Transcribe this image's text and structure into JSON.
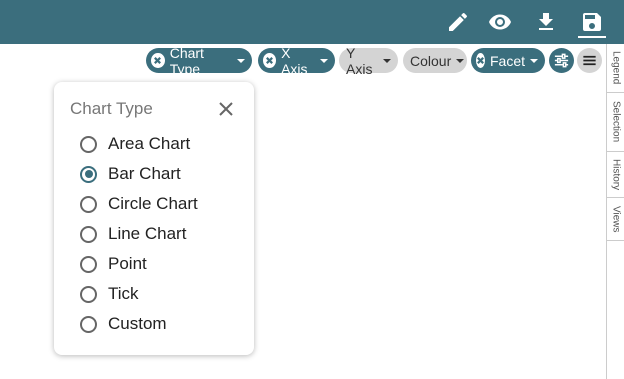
{
  "toolbar": {
    "icons": [
      "pencil-icon",
      "eye-icon",
      "download-icon",
      "save-icon"
    ],
    "color": "#3b6e7d"
  },
  "chips": [
    {
      "label": "Chart Type",
      "active": true
    },
    {
      "label": "X Axis",
      "active": true
    },
    {
      "label": "Y Axis",
      "active": false
    },
    {
      "label": "Colour",
      "active": false
    },
    {
      "label": "Facet",
      "active": true
    }
  ],
  "side_tabs": [
    "Legend",
    "Selection",
    "History",
    "Views"
  ],
  "panel": {
    "title": "Chart Type",
    "options": [
      {
        "label": "Area Chart",
        "checked": false
      },
      {
        "label": "Bar Chart",
        "checked": true
      },
      {
        "label": "Circle Chart",
        "checked": false
      },
      {
        "label": "Line Chart",
        "checked": false
      },
      {
        "label": "Point",
        "checked": false
      },
      {
        "label": "Tick",
        "checked": false
      },
      {
        "label": "Custom",
        "checked": false
      }
    ]
  }
}
